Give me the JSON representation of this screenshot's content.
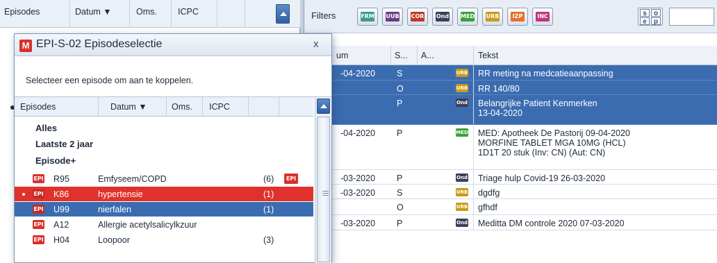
{
  "background_left": {
    "headers": [
      "Episodes",
      "Datum ▼",
      "Oms.",
      "ICPC"
    ]
  },
  "filters": {
    "label": "Filters",
    "chips": [
      {
        "text": "FRM",
        "color": "#3f9a8e"
      },
      {
        "text": "UUB",
        "color": "#6a3b8a"
      },
      {
        "text": "COR",
        "color": "#c0392b"
      },
      {
        "text": "Ond",
        "color": "#3b3f58"
      },
      {
        "text": "MED",
        "color": "#3aa03a"
      },
      {
        "text": "URB",
        "color": "#c99a1a"
      },
      {
        "text": "IZP",
        "color": "#e7702a"
      },
      {
        "text": "INC",
        "color": "#c0357d"
      }
    ],
    "sep_letters": [
      "s",
      "o",
      "e",
      "p"
    ]
  },
  "journal": {
    "headers": [
      "um",
      "S...",
      "A...",
      "Tekst"
    ],
    "rows": [
      {
        "date": "-04-2020",
        "soep": "S",
        "badge": "URB",
        "badge_color": "#c99a1a",
        "text": [
          "RR meting na medcatieaanpassing"
        ],
        "selected": true
      },
      {
        "date": "",
        "soep": "O",
        "badge": "URB",
        "badge_color": "#c99a1a",
        "text": [
          "RR 140/80"
        ],
        "selected": true
      },
      {
        "date": "",
        "soep": "P",
        "badge": "Ond",
        "badge_color": "#3b3f58",
        "text": [
          "Belangrijke Patient Kenmerken",
          "13-04-2020"
        ],
        "selected": true
      },
      {
        "date": "-04-2020",
        "soep": "P",
        "badge": "MED",
        "badge_color": "#3aa03a",
        "text": [
          "MED: Apotheek De Pastorij 09-04-2020",
          "MORFINE TABLET MGA  10MG (HCL)",
          "1D1T 20 stuk (Inv: CN) (Aut: CN)"
        ],
        "selected": false
      },
      {
        "date": "-03-2020",
        "soep": "P",
        "badge": "Ond",
        "badge_color": "#3b3f58",
        "text": [
          "Triage hulp Covid-19 26-03-2020"
        ],
        "selected": false
      },
      {
        "date": "-03-2020",
        "soep": "S",
        "badge": "URB",
        "badge_color": "#c99a1a",
        "text": [
          "dgdfg"
        ],
        "selected": false
      },
      {
        "date": "",
        "soep": "O",
        "badge": "URB",
        "badge_color": "#c99a1a",
        "text": [
          "gfhdf"
        ],
        "selected": false
      },
      {
        "date": "-03-2020",
        "soep": "P",
        "badge": "Ond",
        "badge_color": "#3b3f58",
        "text": [
          "Meditta DM controle 2020 07-03-2020"
        ],
        "selected": false
      }
    ]
  },
  "dialog": {
    "icon_letter": "M",
    "title": "EPI-S-02 Episodeselectie",
    "close": "x",
    "instruction": "Selecteer een episode om aan te koppelen.",
    "headers": [
      "Episodes",
      "Datum ▼",
      "Oms.",
      "ICPC"
    ],
    "groups": [
      "Alles",
      "Laatste 2 jaar",
      "Episode+"
    ],
    "epi_label": "EPI",
    "episodes": [
      {
        "code": "R95",
        "name": "Emfyseem/COPD",
        "count": "(6)",
        "state": "normal",
        "marker": false,
        "extra_icon": true
      },
      {
        "code": "K86",
        "name": "hypertensie",
        "count": "(1)",
        "state": "red",
        "marker": true,
        "extra_icon": false
      },
      {
        "code": "U99",
        "name": "nierfalen",
        "count": "(1)",
        "state": "blue",
        "marker": false,
        "extra_icon": false
      },
      {
        "code": "A12",
        "name": "Allergie acetylsalicylkzuur",
        "count": "",
        "state": "normal",
        "marker": false,
        "extra_icon": false
      },
      {
        "code": "H04",
        "name": "Loopoor",
        "count": "(3)",
        "state": "normal",
        "marker": false,
        "extra_icon": false
      }
    ]
  }
}
